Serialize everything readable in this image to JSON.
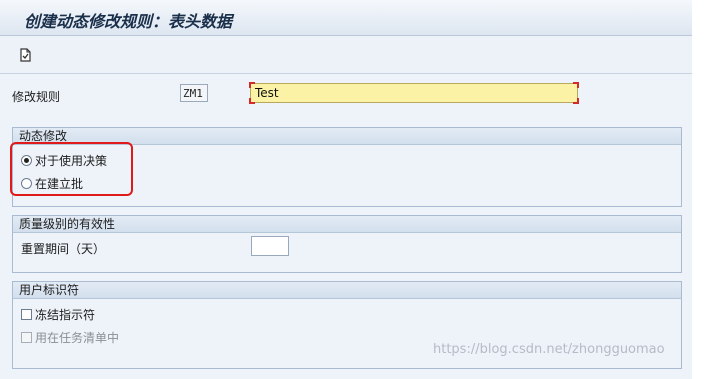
{
  "window": {
    "title": "创建动态修改规则：表头数据"
  },
  "toolbar": {
    "doc_icon": "document-icon"
  },
  "header_row": {
    "label": "修改规则",
    "code_value": "ZM1",
    "text_value": "Test"
  },
  "dynamic_group": {
    "title": "动态修改",
    "options": [
      {
        "label": "对于使用决策",
        "selected": true
      },
      {
        "label": "在建立批",
        "selected": false
      }
    ]
  },
  "quality_group": {
    "title": "质量级别的有效性",
    "reset_label": "重置期间（天）",
    "reset_value": ""
  },
  "user_group": {
    "title": "用户标识符",
    "checks": [
      {
        "label": "冻结指示符",
        "enabled": true,
        "checked": false
      },
      {
        "label": "用在任务清单中",
        "enabled": false,
        "checked": false
      }
    ]
  },
  "watermark": "https://blog.csdn.net/zhongguomao",
  "colors": {
    "highlight": "#e01a1a",
    "required_field": "#fbf2a6",
    "title_text": "#1a2f4a"
  }
}
